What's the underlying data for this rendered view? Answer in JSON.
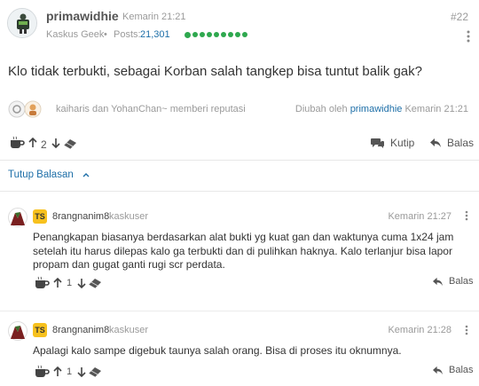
{
  "post": {
    "username": "primawidhie",
    "time": "Kemarin 21:21",
    "number": "#22",
    "rank": "Kaskus Geek",
    "posts_label": "Posts:",
    "posts_count": "21,301",
    "reputation_level": 9,
    "text": "Klo tidak terbukti, sebagai Korban salah tangkep bisa tuntut balik gak?",
    "reputation_givers": "kaiharis dan YohanChan~ memberi reputasi",
    "edited_by_label": "Diubah oleh",
    "edited_by_user": "primawidhie",
    "edited_time": "Kemarin 21:21",
    "vote_count": "2",
    "quote_label": "Kutip",
    "reply_label": "Balas"
  },
  "replies_toggle_label": "Tutup Balasan",
  "comments": [
    {
      "badge": "TS",
      "username": "8rangnanim8",
      "rank": "kaskuser",
      "time": "Kemarin 21:27",
      "text_lines": [
        "Penangkapan biasanya berdasarkan alat bukti yg kuat gan dan waktunya cuma 1x24 jam",
        "setelah itu harus dilepas kalo ga terbukti dan di pulihkan haknya. Kalo terlanjur bisa lapor",
        "propam dan gugat ganti rugi scr perdata."
      ],
      "vote_count": "1",
      "reply_label": "Balas"
    },
    {
      "badge": "TS",
      "username": "8rangnanim8",
      "rank": "kaskuser",
      "time": "Kemarin 21:28",
      "text_lines": [
        "Apalagi kalo sampe digebuk taunya salah orang. Bisa di proses itu oknumnya."
      ],
      "vote_count": "1",
      "reply_label": "Balas"
    }
  ],
  "icons": {
    "more": "more-vertical-icon",
    "coffee": "coffee-cup-icon",
    "upvote": "arrow-up-icon",
    "downvote": "arrow-down-icon",
    "eraser": "eraser-icon",
    "quote": "speech-bubbles-icon",
    "reply": "reply-arrow-icon",
    "chevron": "chevron-up-icon"
  },
  "colors": {
    "link_blue": "#1e6fa8",
    "reputation_green": "#2ea84e",
    "ts_badge": "#f7c11e"
  }
}
